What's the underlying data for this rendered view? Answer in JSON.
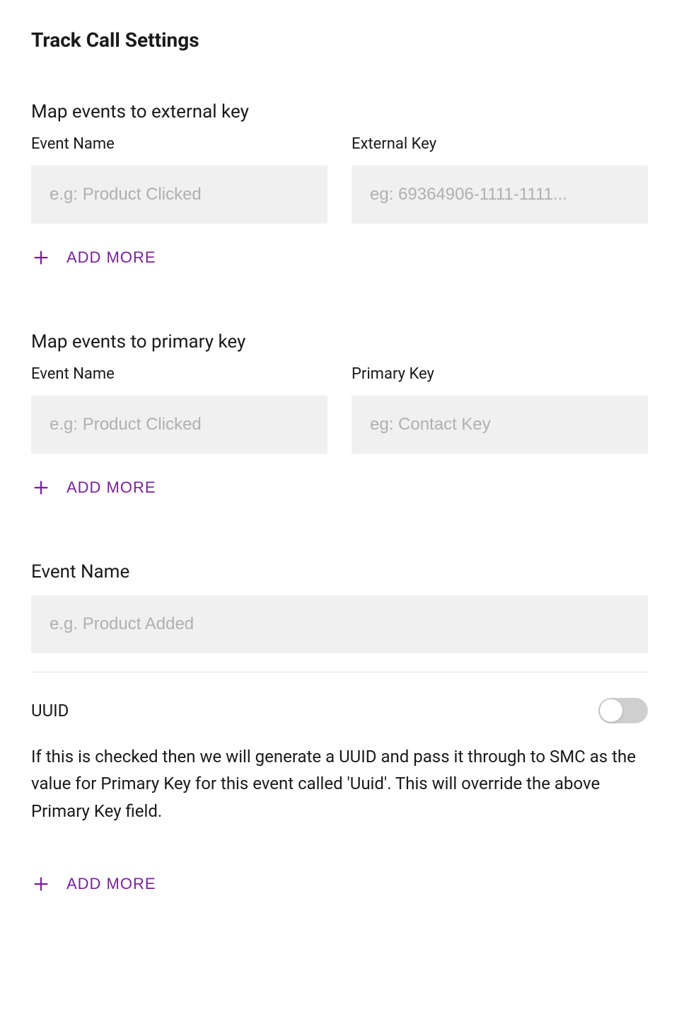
{
  "pageTitle": "Track Call Settings",
  "accentColor": "#7b1fa2",
  "externalKeySection": {
    "heading": "Map events to external key",
    "eventNameLabel": "Event Name",
    "eventNamePlaceholder": "e.g: Product Clicked",
    "externalKeyLabel": "External Key",
    "externalKeyPlaceholder": "eg: 69364906-1111-1111...",
    "addMoreLabel": "ADD MORE"
  },
  "primaryKeySection": {
    "heading": "Map events to primary key",
    "eventNameLabel": "Event Name",
    "eventNamePlaceholder": "e.g: Product Clicked",
    "primaryKeyLabel": "Primary Key",
    "primaryKeyPlaceholder": "eg: Contact Key",
    "addMoreLabel": "ADD MORE"
  },
  "eventNameSection": {
    "label": "Event Name",
    "placeholder": "e.g. Product Added"
  },
  "uuidSection": {
    "label": "UUID",
    "toggleState": false,
    "description": "If this is checked then we will generate a UUID and pass it through to SMC as the value for Primary Key for this event called 'Uuid'. This will override the above Primary Key field.",
    "addMoreLabel": "ADD MORE"
  }
}
